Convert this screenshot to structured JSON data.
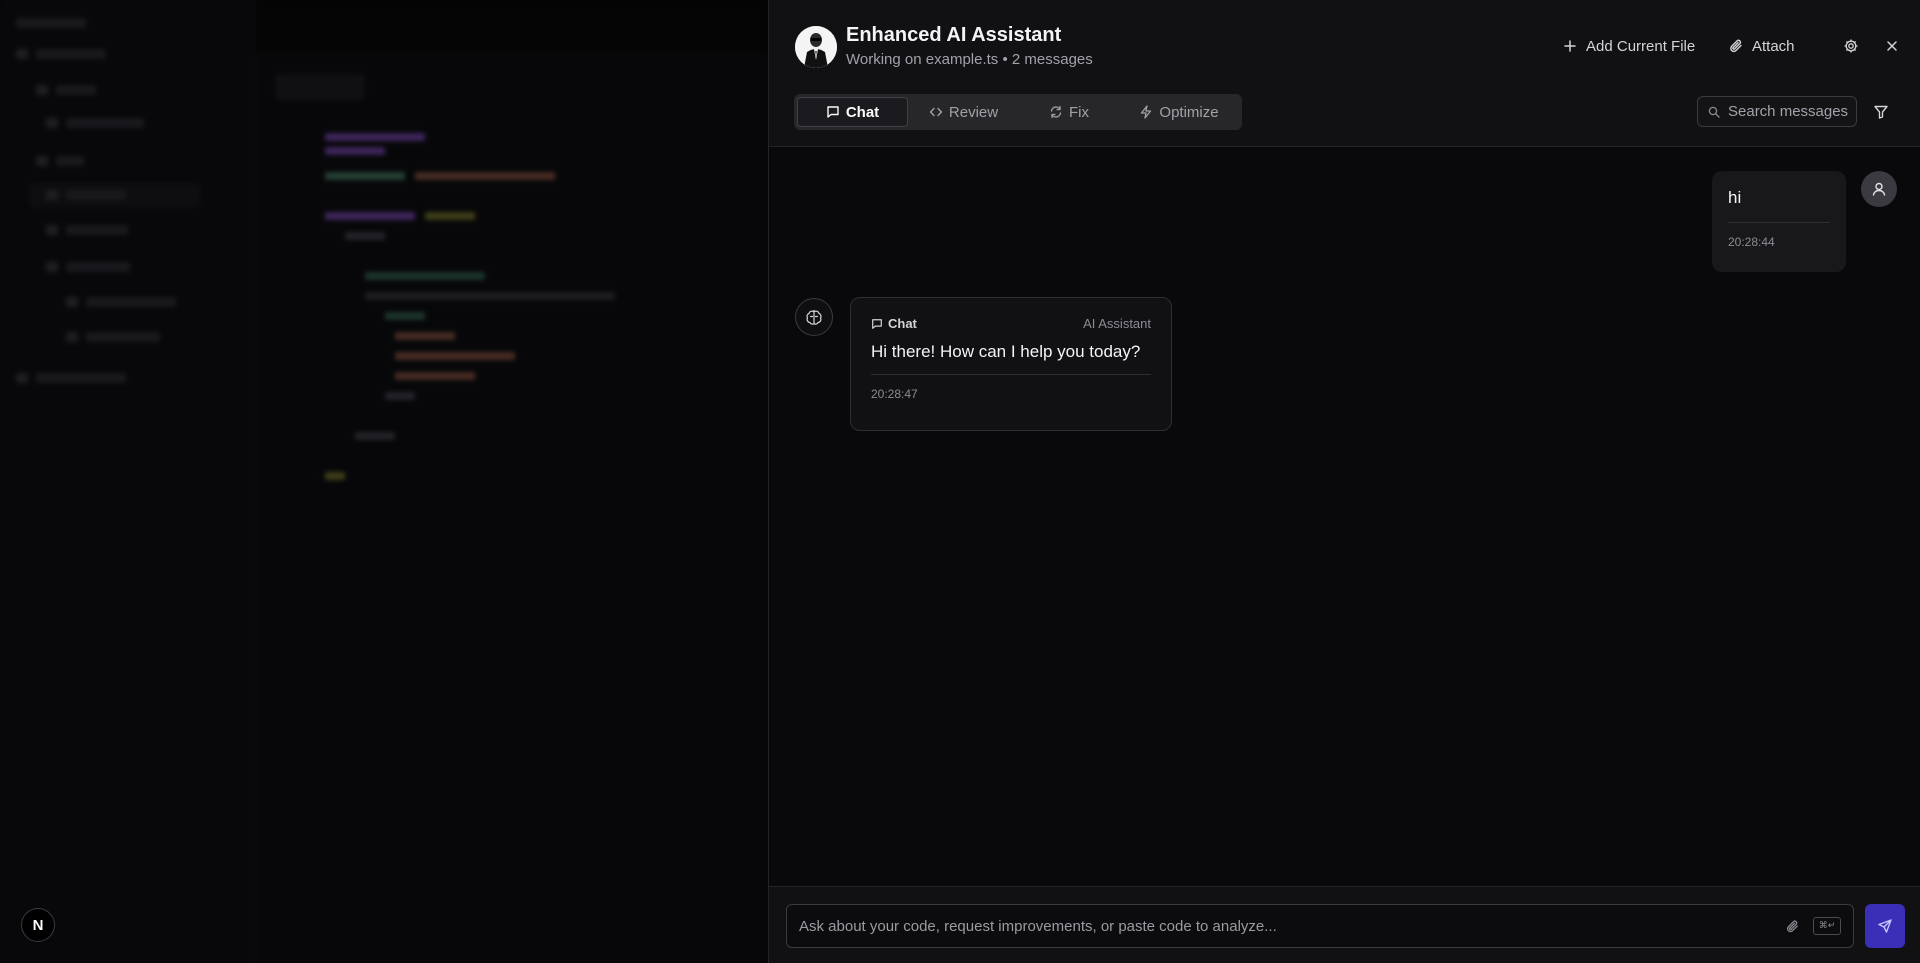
{
  "header": {
    "title": "Enhanced AI Assistant",
    "subtitle": "Working on example.ts • 2 messages",
    "add_file_label": "Add Current File",
    "attach_label": "Attach"
  },
  "tabs": [
    {
      "label": "Chat",
      "icon": "message-square-icon",
      "active": true
    },
    {
      "label": "Review",
      "icon": "code-icon",
      "active": false
    },
    {
      "label": "Fix",
      "icon": "refresh-icon",
      "active": false
    },
    {
      "label": "Optimize",
      "icon": "zap-icon",
      "active": false
    }
  ],
  "search": {
    "placeholder": "Search messages"
  },
  "messages": [
    {
      "role": "user",
      "text": "hi",
      "time": "20:28:44"
    },
    {
      "role": "assistant",
      "mode": "Chat",
      "author": "AI Assistant",
      "text": "Hi there! How can I help you today?",
      "time": "20:28:47"
    }
  ],
  "composer": {
    "placeholder": "Ask about your code, request improvements, or paste code to analyze...",
    "shortcut": "⌘↵"
  },
  "colors": {
    "send_button": "#3b2fb8",
    "panel_bg": "#09090b",
    "header_bg": "#111114"
  }
}
